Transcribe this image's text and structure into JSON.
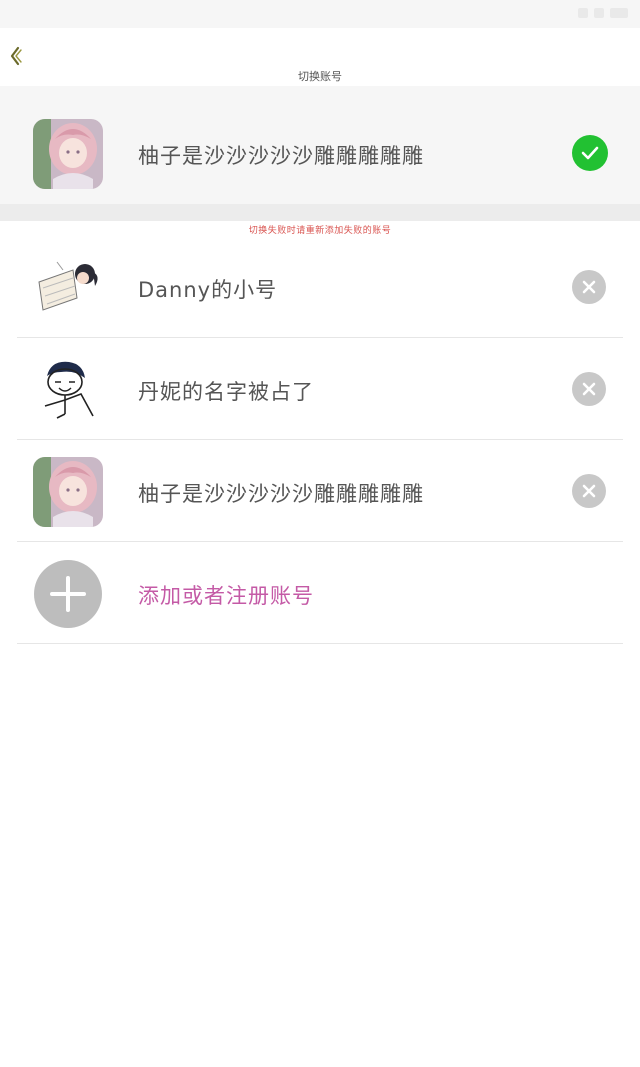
{
  "header": {
    "title": "切换账号",
    "back_icon": "chevron-left-icon"
  },
  "current_account": {
    "name": "柚子是沙沙沙沙沙雕雕雕雕雕",
    "status_icon": "check-icon",
    "status_color": "#22c132"
  },
  "hint": "切换失败时请重新添加失败的账号",
  "accounts": [
    {
      "name": "Danny的小号",
      "action_icon": "close-icon"
    },
    {
      "name": "丹妮的名字被占了",
      "action_icon": "close-icon"
    },
    {
      "name": "柚子是沙沙沙沙沙雕雕雕雕雕",
      "action_icon": "close-icon"
    }
  ],
  "add_account": {
    "label": "添加或者注册账号",
    "icon": "plus-icon",
    "color": "#c45aa6"
  }
}
